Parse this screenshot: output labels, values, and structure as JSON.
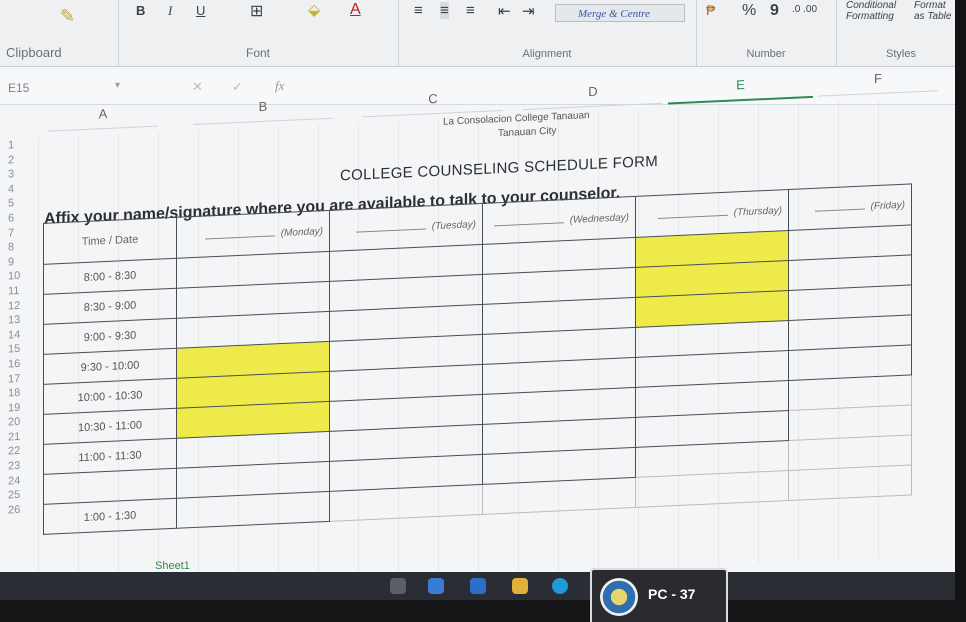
{
  "ribbon": {
    "groups": {
      "clipboard": "Clipboard",
      "font": "Font",
      "alignment": "Alignment",
      "number": "Number",
      "styles": "Styles"
    },
    "bold": "B",
    "italic": "I",
    "underline": "U",
    "merge_centre": "Merge & Centre",
    "percent": "%",
    "comma": "9",
    "conditional_formatting": "Conditional Formatting",
    "format_as_table": "Format as Table"
  },
  "formula_bar": {
    "name_box": "E15",
    "fx": "fx"
  },
  "columns": [
    "A",
    "B",
    "C",
    "D",
    "E",
    "F"
  ],
  "rows": [
    "1",
    "2",
    "3",
    "4",
    "5",
    "6",
    "7",
    "8",
    "9",
    "10",
    "11",
    "12",
    "13",
    "14",
    "15",
    "16",
    "17",
    "18",
    "19",
    "20",
    "21",
    "22",
    "23",
    "24",
    "25",
    "26"
  ],
  "document": {
    "school": "La Consolacion College Tanauan",
    "city": "Tanauan City",
    "form_title": "COLLEGE COUNSELING SCHEDULE FORM",
    "instruction": "Affix your name/signature where you are available to talk to your counselor."
  },
  "table": {
    "time_header": "Time / Date",
    "days": [
      "(Monday)",
      "(Tuesday)",
      "(Wednesday)",
      "(Thursday)",
      "(Friday)"
    ],
    "time_slots": [
      "8:00 - 8:30",
      "8:30 - 9:00",
      "9:00 - 9:30",
      "9:30 - 10:00",
      "10:00 - 10:30",
      "10:30 - 11:00",
      "11:00 - 11:30",
      "",
      "1:00 - 1:30"
    ],
    "highlight_color": "#eeea4a"
  },
  "sheet_tab": "Sheet1",
  "monitor_sticker": "PC - 37"
}
